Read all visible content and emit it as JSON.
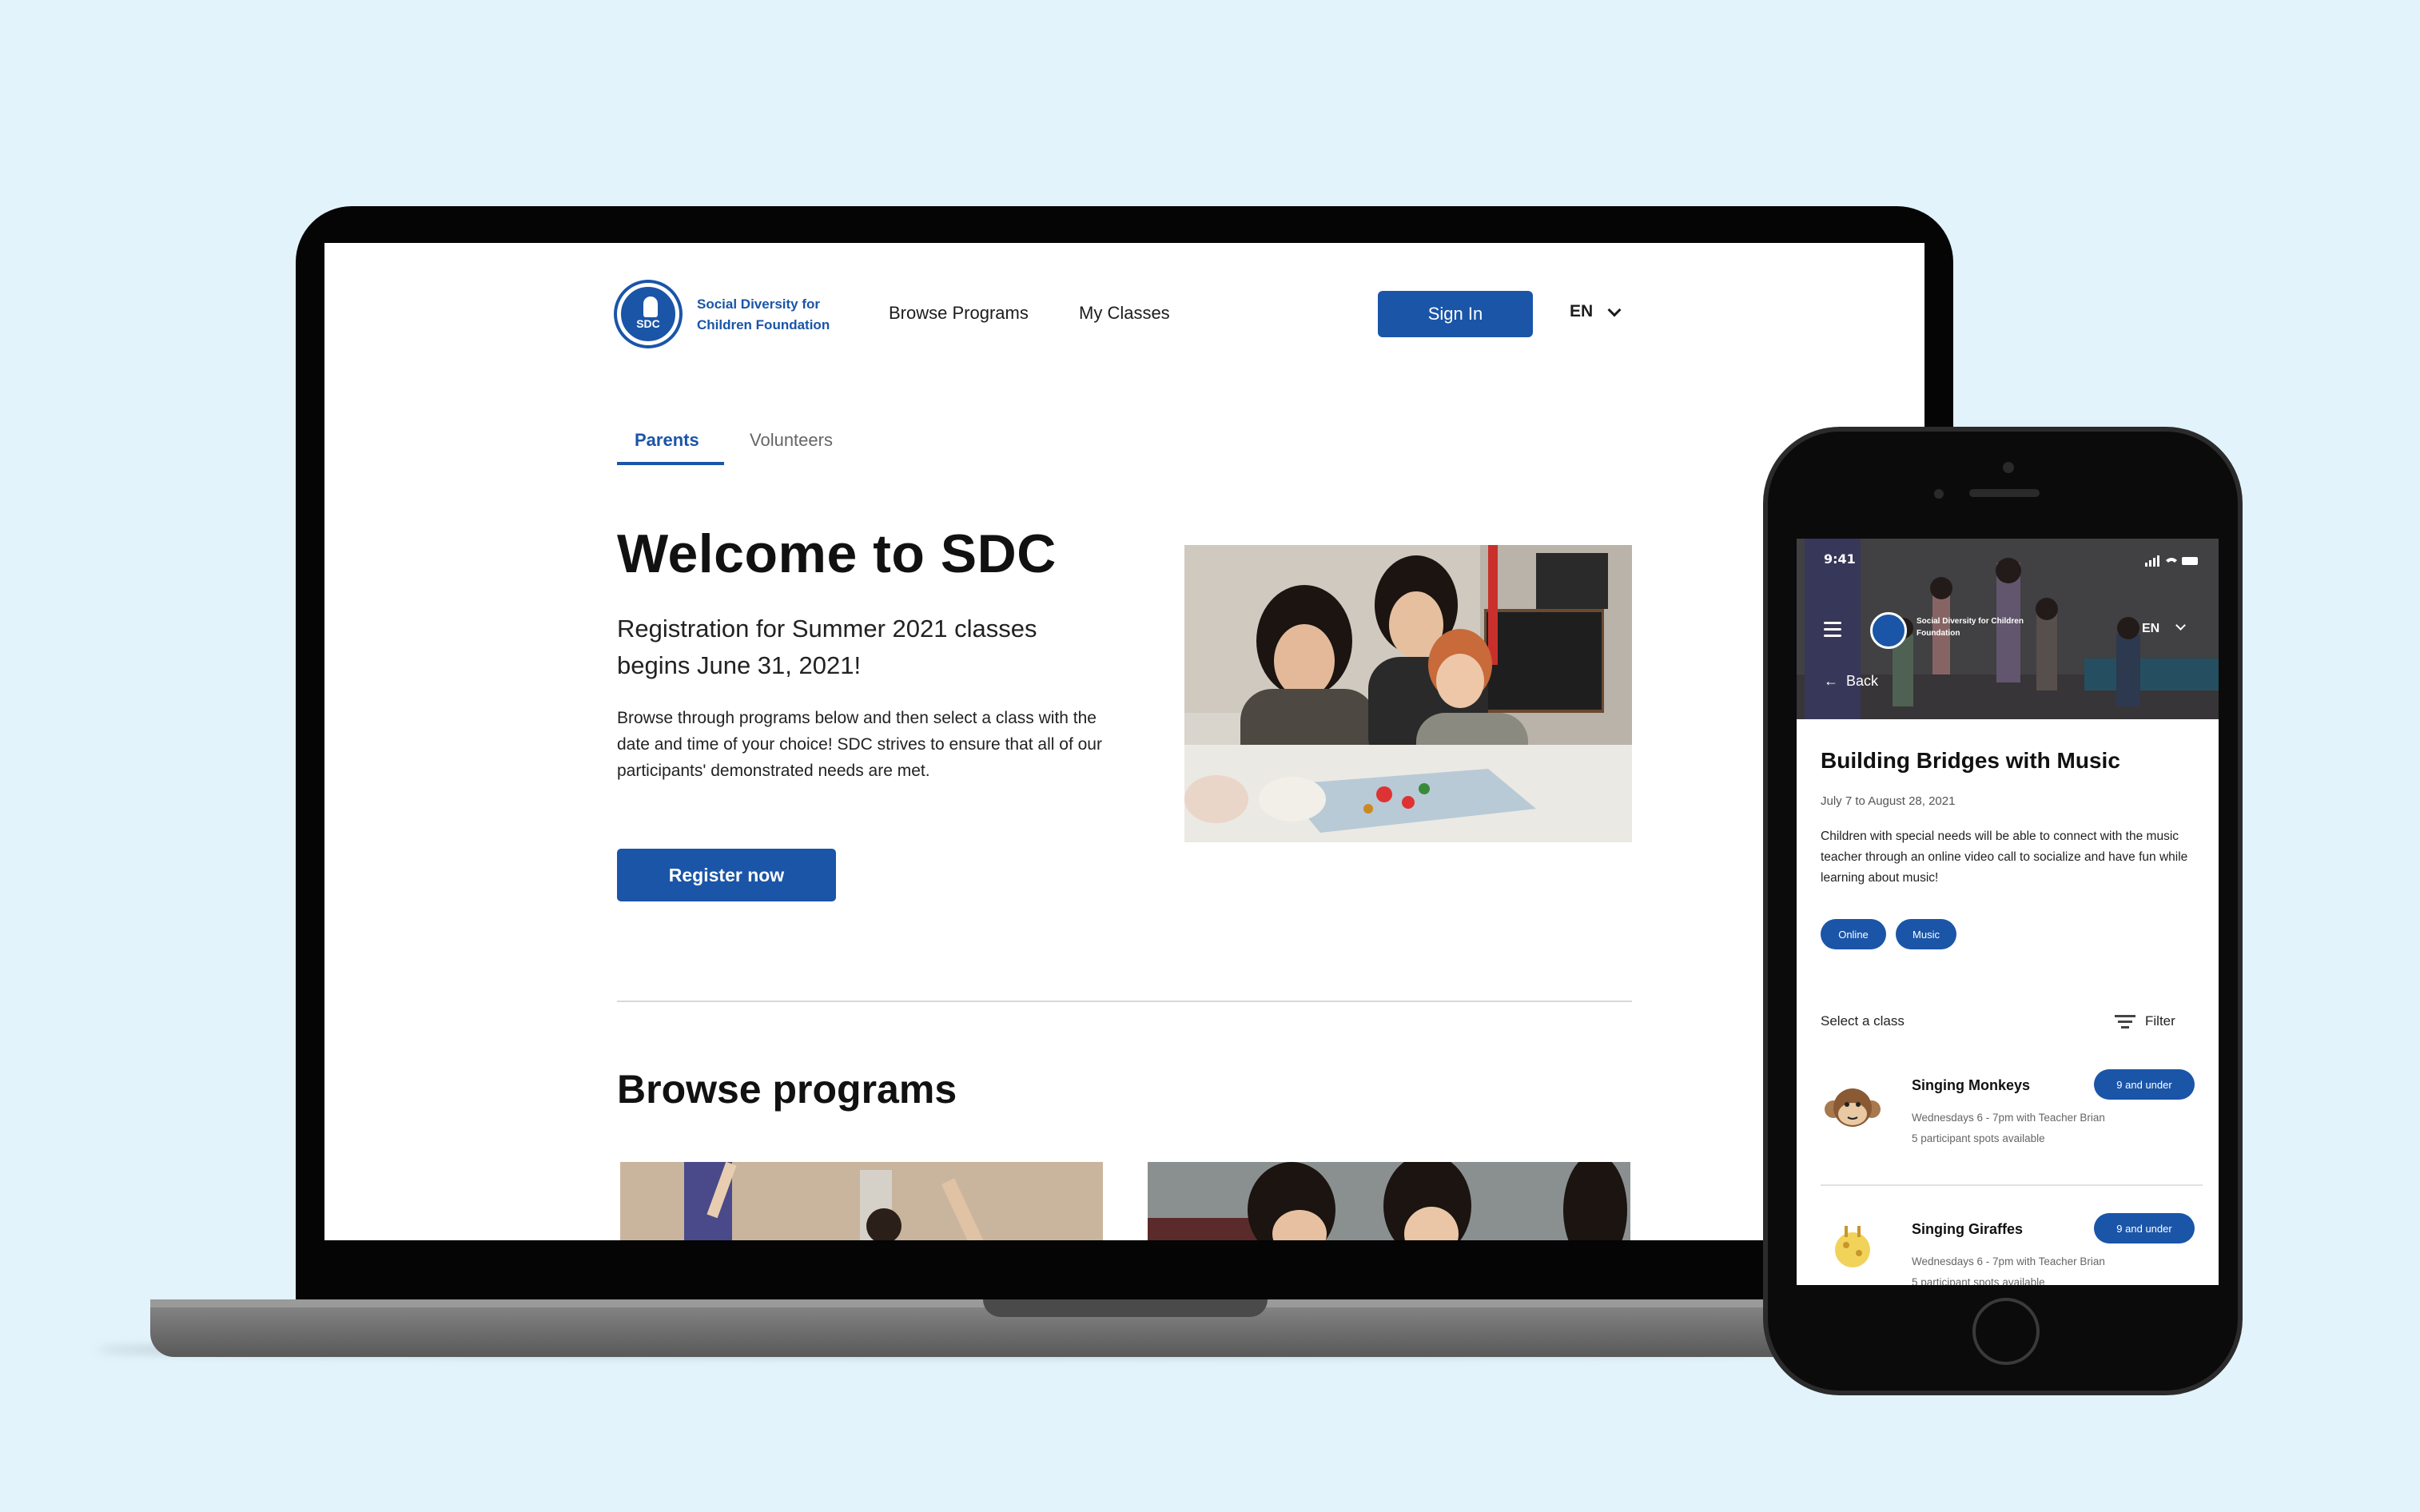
{
  "laptop": {
    "org_name_line1": "Social Diversity for",
    "org_name_line2": "Children Foundation",
    "logo_text": "SDC",
    "nav": {
      "browse": "Browse Programs",
      "classes": "My Classes"
    },
    "signin_label": "Sign In",
    "lang": "EN",
    "tabs": {
      "parents": "Parents",
      "volunteers": "Volunteers"
    },
    "hero": {
      "title": "Welcome to SDC",
      "subtitle": "Registration for Summer 2021 classes begins June 31, 2021!",
      "body": "Browse through programs below and then select a class with the date and time of your choice! SDC strives to ensure that all of our participants' demonstrated needs are met.",
      "cta": "Register now"
    },
    "browse_title": "Browse programs"
  },
  "phone": {
    "time": "9:41",
    "org_name": "Social Diversity for Children Foundation",
    "lang": "EN",
    "back_label": "Back",
    "program": {
      "title": "Building Bridges with Music",
      "dates": "July 7 to August 28, 2021",
      "description": "Children with special needs will be able to connect with the music teacher through an online video call to socialize and have fun while learning about music!",
      "tags": [
        "Online",
        "Music"
      ]
    },
    "select_label": "Select a class",
    "filter_label": "Filter",
    "classes": [
      {
        "name": "Singing Monkeys",
        "badge": "9 and under",
        "schedule": "Wednesdays 6 - 7pm with Teacher Brian",
        "spots": "5 participant spots available"
      },
      {
        "name": "Singing Giraffes",
        "badge": "9 and under",
        "schedule": "Wednesdays 6 - 7pm with Teacher Brian",
        "spots": "5 participant spots available"
      }
    ]
  },
  "colors": {
    "brand_blue": "#1a55a8",
    "background": "#e2f3fb"
  }
}
